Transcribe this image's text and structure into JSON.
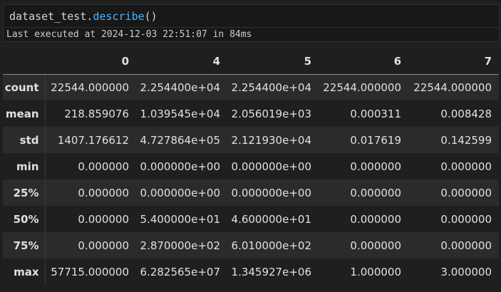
{
  "cell": {
    "code_object": "dataset_test.",
    "code_method": "describe",
    "code_parens": "()",
    "status": "Last executed at 2024-12-03 22:51:07 in 84ms"
  },
  "table": {
    "columns": [
      "0",
      "4",
      "5",
      "6",
      "7"
    ],
    "rows": [
      {
        "label": "count",
        "cells": [
          "22544.000000",
          "2.254400e+04",
          "2.254400e+04",
          "22544.000000",
          "22544.000000"
        ]
      },
      {
        "label": "mean",
        "cells": [
          "218.859076",
          "1.039545e+04",
          "2.056019e+03",
          "0.000311",
          "0.008428"
        ]
      },
      {
        "label": "std",
        "cells": [
          "1407.176612",
          "4.727864e+05",
          "2.121930e+04",
          "0.017619",
          "0.142599"
        ]
      },
      {
        "label": "min",
        "cells": [
          "0.000000",
          "0.000000e+00",
          "0.000000e+00",
          "0.000000",
          "0.000000"
        ]
      },
      {
        "label": "25%",
        "cells": [
          "0.000000",
          "0.000000e+00",
          "0.000000e+00",
          "0.000000",
          "0.000000"
        ]
      },
      {
        "label": "50%",
        "cells": [
          "0.000000",
          "5.400000e+01",
          "4.600000e+01",
          "0.000000",
          "0.000000"
        ]
      },
      {
        "label": "75%",
        "cells": [
          "0.000000",
          "2.870000e+02",
          "6.010000e+02",
          "0.000000",
          "0.000000"
        ]
      },
      {
        "label": "max",
        "cells": [
          "57715.000000",
          "6.282565e+07",
          "1.345927e+06",
          "1.000000",
          "3.000000"
        ]
      }
    ]
  }
}
